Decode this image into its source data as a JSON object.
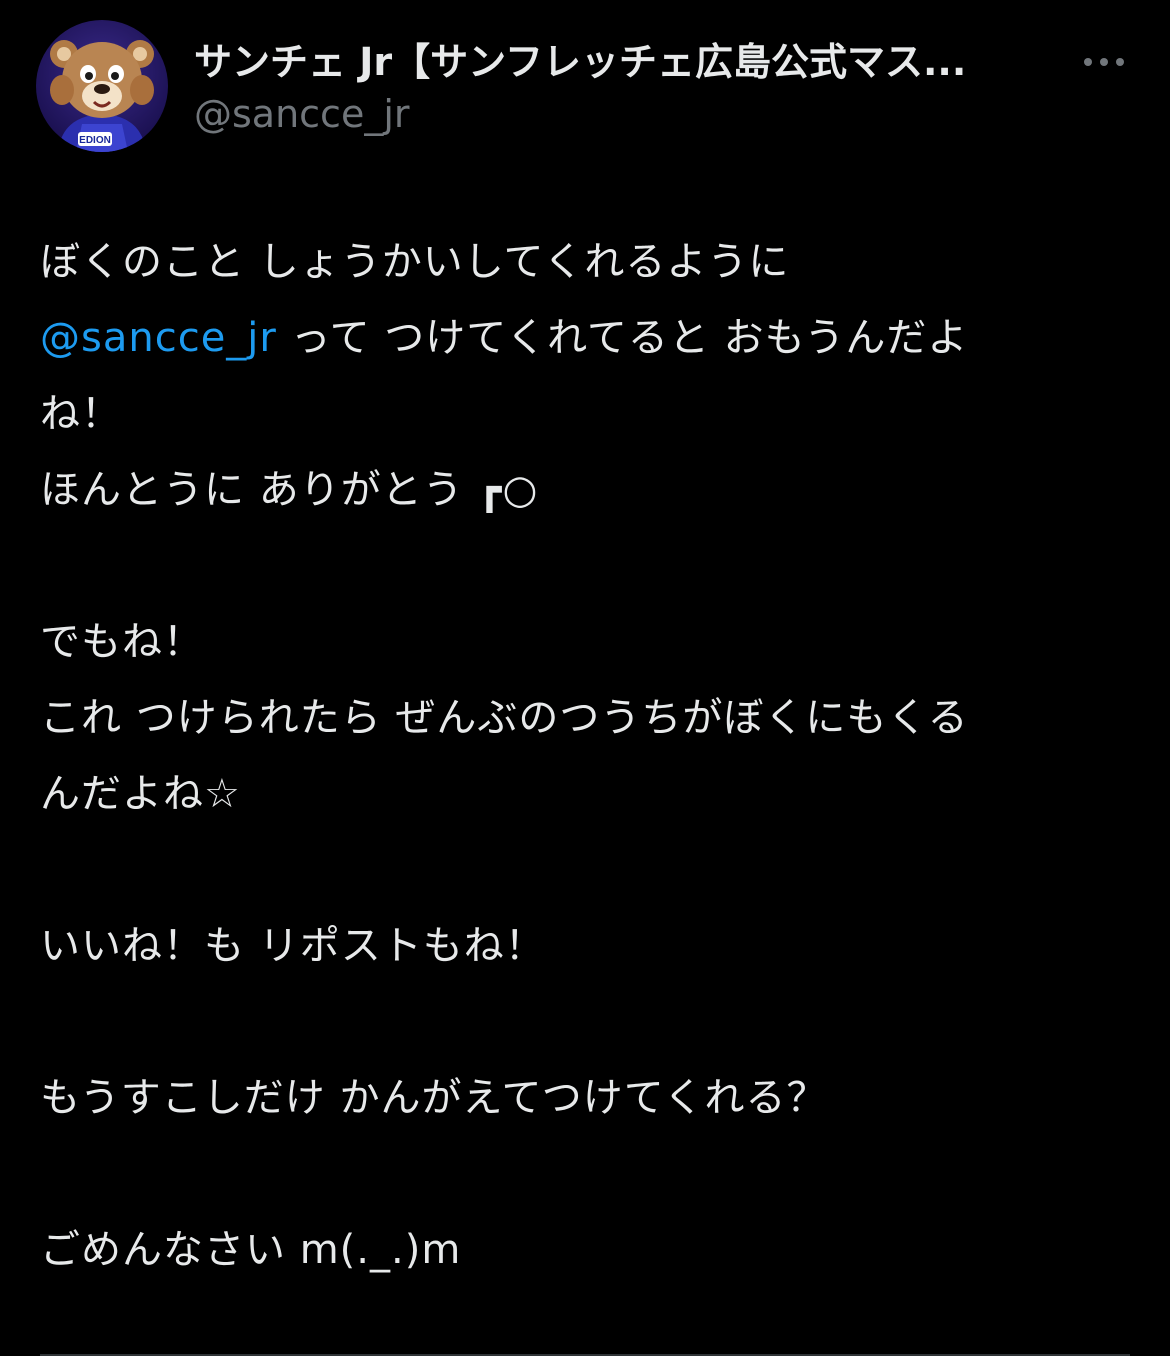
{
  "author": {
    "display_name": "サンチェ Jr【サンフレッチェ広島公式マス...",
    "handle": "@sancce_jr",
    "avatar_icon": "mascot-avatar-icon",
    "avatar_badge_text": "EDION"
  },
  "more_icon": "more-horizontal-icon",
  "tweet": {
    "line1": "ぼくのこと しょうかいしてくれるように",
    "line2_mention": "@sancce_jr",
    "line2_rest": " って つけてくれてると おもうんだよ",
    "line3": "ね！",
    "line4": "ほんとうに ありがとう ┏○",
    "line5": "でもね！",
    "line6": "これ つけられたら ぜんぶのつうちがぼくにもくる",
    "line7": "んだよね☆",
    "line8": "いいね！も リポストもね！",
    "line9": "もうすこしだけ かんがえてつけてくれる？",
    "line10": "ごめんなさい m(._.)m"
  },
  "colors": {
    "background": "#000000",
    "text": "#e7e9ea",
    "secondary": "#71767b",
    "link": "#1d9bf0"
  }
}
